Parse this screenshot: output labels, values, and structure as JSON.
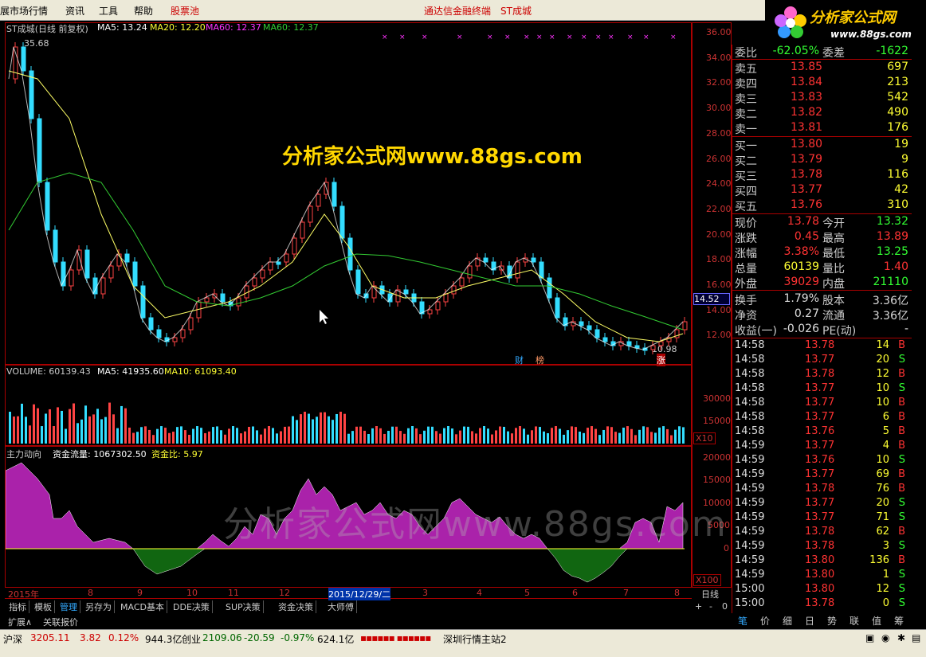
{
  "menubar": {
    "items": [
      "展市场行情",
      "资讯",
      "工具",
      "帮助",
      "股票池"
    ],
    "app_title": "通达信金融终端",
    "stock_title": "ST成城"
  },
  "logo": {
    "text": "分析家公式网",
    "url": "www.88gs.com"
  },
  "main_chart": {
    "header": "ST成城(日线 前复权)",
    "ma5": "MA5: 13.24",
    "ma20": "MA20: 12.20",
    "ma60a": "MA60: 12.37",
    "ma60b": "MA60: 12.37",
    "high_label": "35.68",
    "low_label": "10.98",
    "current_price_tag": "14.52",
    "ticks": [
      "36.00",
      "34.00",
      "32.00",
      "30.00",
      "28.00",
      "26.00",
      "24.00",
      "22.00",
      "20.00",
      "18.00",
      "16.00",
      "14.00",
      "12.00"
    ],
    "markers": [
      "财",
      "榜",
      "涨"
    ]
  },
  "volume_chart": {
    "header": "VOLUME: 60139.43",
    "ma5": "MA5: 41935.60",
    "ma10": "MA10: 61093.40",
    "ticks": [
      "30000",
      "15000"
    ],
    "unit": "X10"
  },
  "flow_chart": {
    "title": "主力动向",
    "flow": "资金流量: 1067302.50",
    "ratio": "资金比: 5.97",
    "ticks": [
      "20000",
      "15000",
      "10000",
      "5000",
      "0"
    ],
    "unit": "X100"
  },
  "x_axis": {
    "labels": [
      "2015年",
      "8",
      "9",
      "10",
      "11",
      "12",
      "2015/12/29/二",
      "3",
      "4",
      "5",
      "6",
      "7",
      "8"
    ],
    "period": "日线"
  },
  "watermarks": {
    "top": "分析家公式网www.88gs.com",
    "bottom": "分析家公式网www.88gs.com"
  },
  "order_book": {
    "ratio": {
      "label": "委比",
      "value": "-62.05%",
      "diff_label": "委差",
      "diff": "-1622"
    },
    "asks": [
      {
        "label": "卖五",
        "price": "13.85",
        "vol": "697"
      },
      {
        "label": "卖四",
        "price": "13.84",
        "vol": "213"
      },
      {
        "label": "卖三",
        "price": "13.83",
        "vol": "542"
      },
      {
        "label": "卖二",
        "price": "13.82",
        "vol": "490"
      },
      {
        "label": "卖一",
        "price": "13.81",
        "vol": "176"
      }
    ],
    "bids": [
      {
        "label": "买一",
        "price": "13.80",
        "vol": "19"
      },
      {
        "label": "买二",
        "price": "13.79",
        "vol": "9"
      },
      {
        "label": "买三",
        "price": "13.78",
        "vol": "116"
      },
      {
        "label": "买四",
        "price": "13.77",
        "vol": "42"
      },
      {
        "label": "买五",
        "price": "13.76",
        "vol": "310"
      }
    ]
  },
  "quote": [
    {
      "k1": "现价",
      "v1": "13.78",
      "k2": "今开",
      "v2": "13.32",
      "c1": "#ff3333",
      "c2": "#33ff33"
    },
    {
      "k1": "涨跌",
      "v1": "0.45",
      "k2": "最高",
      "v2": "13.89",
      "c1": "#ff3333",
      "c2": "#ff3333"
    },
    {
      "k1": "涨幅",
      "v1": "3.38%",
      "k2": "最低",
      "v2": "13.25",
      "c1": "#ff3333",
      "c2": "#33ff33"
    },
    {
      "k1": "总量",
      "v1": "60139",
      "k2": "量比",
      "v2": "1.40",
      "c1": "#ffff33",
      "c2": "#ff3333"
    },
    {
      "k1": "外盘",
      "v1": "39029",
      "k2": "内盘",
      "v2": "21110",
      "c1": "#ff3333",
      "c2": "#33ff33"
    }
  ],
  "finance": [
    {
      "k1": "换手",
      "v1": "1.79%",
      "k2": "股本",
      "v2": "3.36亿"
    },
    {
      "k1": "净资",
      "v1": "0.27",
      "k2": "流通",
      "v2": "3.36亿"
    },
    {
      "k1": "收益(一)",
      "v1": "-0.026",
      "k2": "PE(动)",
      "v2": "-"
    }
  ],
  "ticks_list": [
    {
      "t": "14:58",
      "p": "13.78",
      "v": "14",
      "s": "B"
    },
    {
      "t": "14:58",
      "p": "13.77",
      "v": "20",
      "s": "S"
    },
    {
      "t": "14:58",
      "p": "13.78",
      "v": "12",
      "s": "B"
    },
    {
      "t": "14:58",
      "p": "13.77",
      "v": "10",
      "s": "S"
    },
    {
      "t": "14:58",
      "p": "13.77",
      "v": "10",
      "s": "B"
    },
    {
      "t": "14:58",
      "p": "13.77",
      "v": "6",
      "s": "B"
    },
    {
      "t": "14:58",
      "p": "13.76",
      "v": "5",
      "s": "B"
    },
    {
      "t": "14:59",
      "p": "13.77",
      "v": "4",
      "s": "B"
    },
    {
      "t": "14:59",
      "p": "13.76",
      "v": "10",
      "s": "S"
    },
    {
      "t": "14:59",
      "p": "13.77",
      "v": "69",
      "s": "B"
    },
    {
      "t": "14:59",
      "p": "13.78",
      "v": "76",
      "s": "B"
    },
    {
      "t": "14:59",
      "p": "13.77",
      "v": "20",
      "s": "S"
    },
    {
      "t": "14:59",
      "p": "13.77",
      "v": "71",
      "s": "S"
    },
    {
      "t": "14:59",
      "p": "13.78",
      "v": "62",
      "s": "B"
    },
    {
      "t": "14:59",
      "p": "13.78",
      "v": "3",
      "s": "S"
    },
    {
      "t": "14:59",
      "p": "13.80",
      "v": "136",
      "s": "B"
    },
    {
      "t": "14:59",
      "p": "13.80",
      "v": "1",
      "s": "S"
    },
    {
      "t": "15:00",
      "p": "13.80",
      "v": "12",
      "s": "S"
    },
    {
      "t": "15:00",
      "p": "13.78",
      "v": "0",
      "s": "S"
    }
  ],
  "bottom_tabs": [
    "指标",
    "模板",
    "管理",
    "另存为",
    "MACD基本",
    "DDE决策",
    "SUP决策",
    "资金决策",
    "大师傅"
  ],
  "bottom_tabs2": [
    "扩展∧",
    "关联报价"
  ],
  "right_tabs": [
    "笔",
    "价",
    "细",
    "日",
    "势",
    "联",
    "值",
    "筹"
  ],
  "nav_buttons": [
    "+",
    "-",
    "0"
  ],
  "status": {
    "index_name": "沪深",
    "index_val": "3205.11",
    "index_chg": "3.82",
    "index_pct": "0.12%",
    "index_amt": "944.3亿",
    "cy_name": "创业",
    "cy_val": "2109.06",
    "cy_chg": "-20.59",
    "cy_pct": "-0.97%",
    "cy_amt": "624.1亿",
    "server": "深圳行情主站2"
  }
}
